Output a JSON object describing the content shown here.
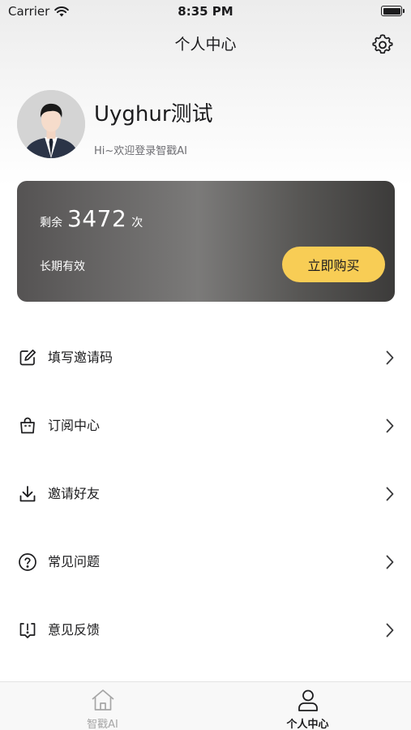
{
  "status_bar": {
    "carrier": "Carrier",
    "time": "8:35 PM"
  },
  "header": {
    "title": "个人中心",
    "settings_icon": "gear-icon"
  },
  "profile": {
    "username": "Uyghur测试",
    "welcome": "Hi~欢迎登录智戳AI"
  },
  "balance": {
    "prefix": "剩余",
    "count": "3472",
    "unit": "次",
    "validity": "长期有效",
    "buy_label": "立即购买",
    "button_color": "#f8cd55"
  },
  "menu": [
    {
      "label": "填写邀请码",
      "icon": "edit-icon"
    },
    {
      "label": "订阅中心",
      "icon": "shopping-bag-icon"
    },
    {
      "label": "邀请好友",
      "icon": "download-icon"
    },
    {
      "label": "常见问题",
      "icon": "help-circle-icon"
    },
    {
      "label": "意见反馈",
      "icon": "feedback-icon"
    }
  ],
  "tabbar": {
    "home_label": "智戳AI",
    "profile_label": "个人中心",
    "active": "个人中心"
  }
}
